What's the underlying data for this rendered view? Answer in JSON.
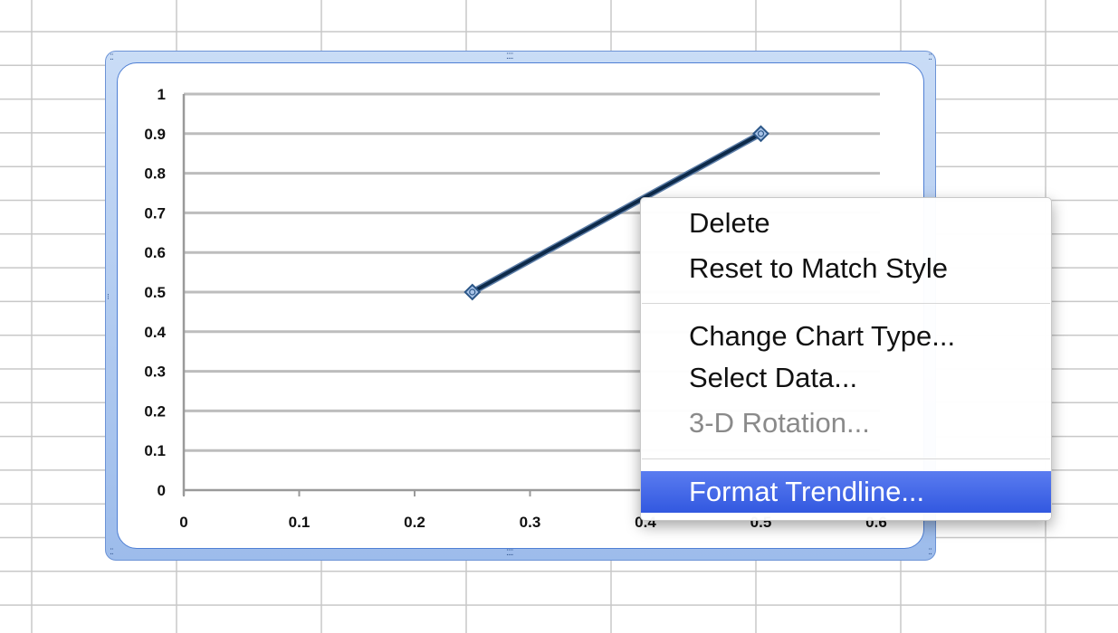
{
  "chart_data": {
    "type": "scatter",
    "x_ticks": [
      "0",
      "0.1",
      "0.2",
      "0.3",
      "0.4",
      "0.5",
      "0.6"
    ],
    "y_ticks": [
      "0",
      "0.1",
      "0.2",
      "0.3",
      "0.4",
      "0.5",
      "0.6",
      "0.7",
      "0.8",
      "0.9",
      "1"
    ],
    "xlim": [
      0,
      0.6
    ],
    "ylim": [
      0,
      1
    ],
    "grid": "horizontal",
    "series": [
      {
        "x": [
          0.25,
          0.5
        ],
        "y": [
          0.5,
          0.9
        ],
        "marker": "diamond",
        "line": true
      }
    ],
    "colors": {
      "line": "#0d2a4a",
      "marker_fill": "#a9c4e8",
      "grid": "#bdbdbd",
      "axis": "#9a9a9a"
    }
  },
  "context_menu": {
    "items": [
      {
        "label": "Delete",
        "enabled": true
      },
      {
        "label": "Reset to Match Style",
        "enabled": true
      },
      {
        "label": "Change Chart Type...",
        "enabled": true
      },
      {
        "label": "Select Data...",
        "enabled": true
      },
      {
        "label": "3-D Rotation...",
        "enabled": false
      },
      {
        "label": "Format Trendline...",
        "enabled": true,
        "highlighted": true
      }
    ]
  },
  "colors": {
    "selection_frame": "#9dbceb",
    "menu_highlight": "#3d63e6",
    "sheet_grid": "#c8c8c8"
  }
}
